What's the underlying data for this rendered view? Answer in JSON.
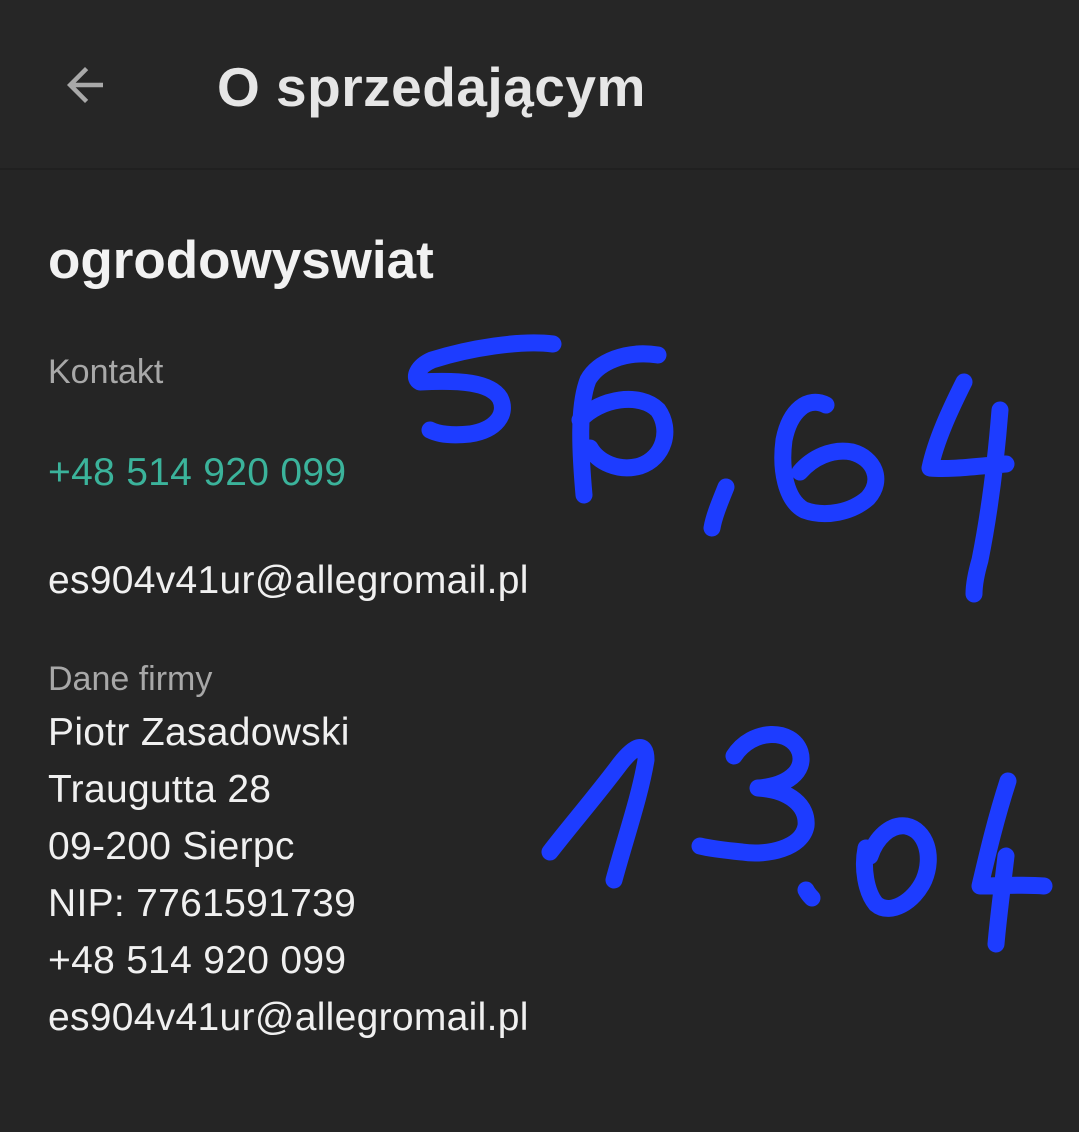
{
  "header": {
    "back_icon": "arrow-left-icon",
    "title": "O sprzedającym"
  },
  "seller": {
    "name": "ogrodowyswiat"
  },
  "contact": {
    "label": "Kontakt",
    "phone": "+48 514 920 099",
    "email": "es904v41ur@allegromail.pl"
  },
  "company": {
    "label": "Dane firmy",
    "lines": [
      "Piotr Zasadowski",
      "Traugutta 28",
      "09-200 Sierpc",
      "NIP: 7761591739",
      "+48 514 920 099",
      "es904v41ur@allegromail.pl"
    ]
  },
  "handwriting": {
    "color": "#1d3cff",
    "texts": [
      "56,64",
      "13.04"
    ]
  },
  "colors": {
    "background": "#252525",
    "accent_link": "#3bb39b"
  }
}
